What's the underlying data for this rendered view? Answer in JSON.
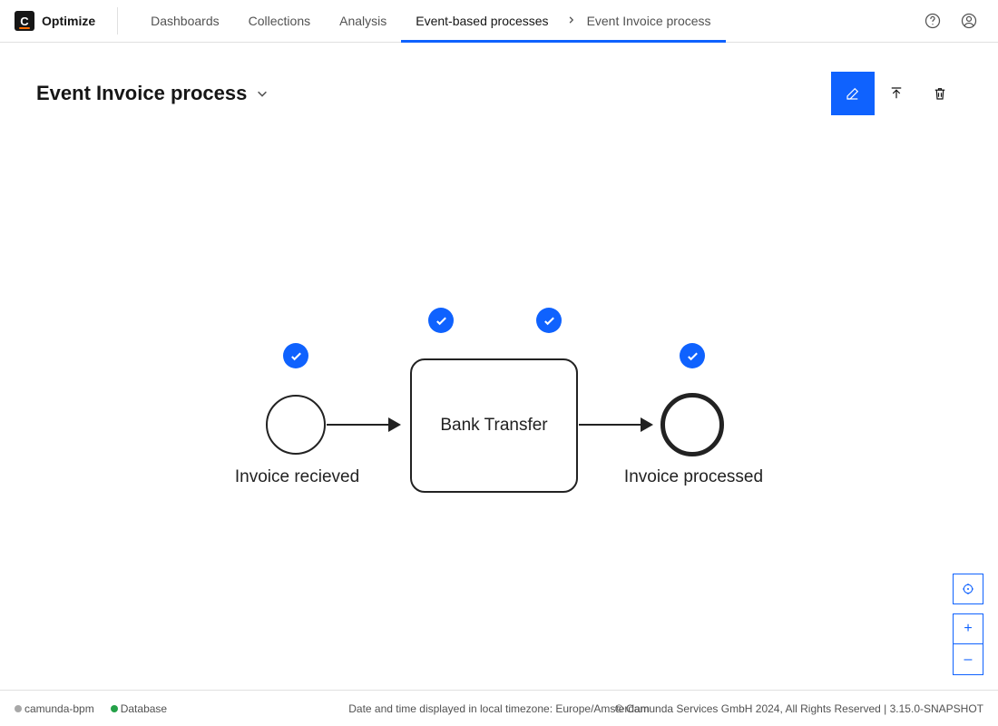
{
  "brand": {
    "name": "Optimize"
  },
  "nav": {
    "items": [
      "Dashboards",
      "Collections",
      "Analysis",
      "Event-based processes"
    ],
    "active_index": 3,
    "breadcrumb_current": "Event Invoice process"
  },
  "page": {
    "title": "Event Invoice process"
  },
  "diagram": {
    "task_label": "Bank Transfer",
    "start_label": "Invoice recieved",
    "end_label": "Invoice processed"
  },
  "footer": {
    "status1_label": "camunda-bpm",
    "status2_label": "Database",
    "timezone_text": "Date and time displayed in local timezone: Europe/Amsterdam",
    "copyright": "© Camunda Services GmbH 2024, All Rights Reserved | 3.15.0-SNAPSHOT"
  },
  "zoom": {
    "plus": "+",
    "minus": "–"
  }
}
